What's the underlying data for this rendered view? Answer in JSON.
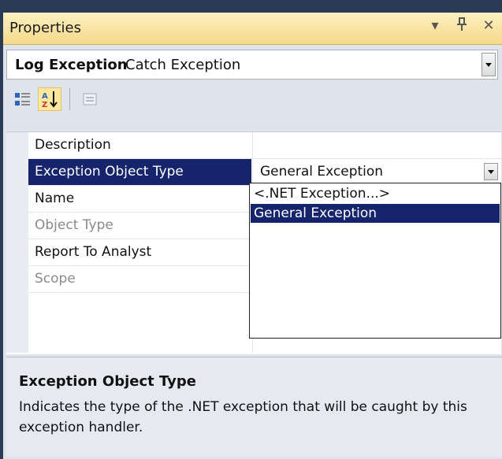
{
  "window": {
    "title": "Properties",
    "icons": [
      "dropdown-arrow-icon",
      "pin-icon",
      "close-icon"
    ]
  },
  "object_selector": {
    "name": "Log Exception",
    "type": "Catch Exception"
  },
  "toolbar": {
    "buttons": [
      "categorized-icon",
      "alphabetical-icon",
      "property-pages-icon"
    ]
  },
  "grid": {
    "rows": [
      {
        "name": "Description",
        "value": "",
        "enabled": true
      },
      {
        "name": "Exception Object Type",
        "value": "General Exception",
        "enabled": true,
        "selected": true
      },
      {
        "name": "Name",
        "value": "",
        "enabled": true
      },
      {
        "name": "Object Type",
        "value": "",
        "enabled": false
      },
      {
        "name": "Report To Analyst",
        "value": "",
        "enabled": true
      },
      {
        "name": "Scope",
        "value": "",
        "enabled": false
      }
    ]
  },
  "dropdown": {
    "options": [
      "<.NET Exception...>",
      "General Exception"
    ],
    "selected": "General Exception"
  },
  "description": {
    "title": "Exception Object Type",
    "text": "Indicates the type of the .NET exception that will be caught by this exception handler."
  },
  "colors": {
    "selection": "#15246b",
    "titlebar": "#f5d98a",
    "frame": "#2b3a55"
  }
}
